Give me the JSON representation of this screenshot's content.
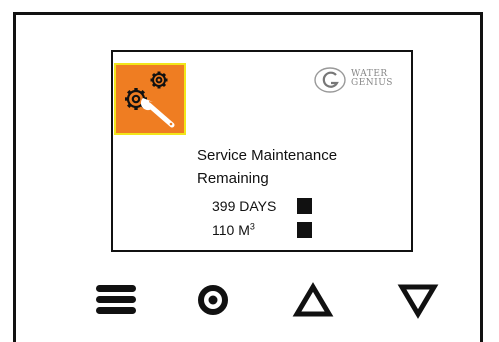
{
  "screen": {
    "icon": "service-gears-wrench-icon",
    "logo": {
      "icon": "water-genius-g-logo-icon",
      "line1": "WATER",
      "line2": "GENIUS"
    },
    "title_line1": "Service Maintenance",
    "title_line2": "Remaining",
    "rows": [
      {
        "label": "399 DAYS",
        "indicator": "filled-square"
      },
      {
        "label": "110 M",
        "superscript": "3",
        "indicator": "filled-square"
      }
    ]
  },
  "buttons": [
    {
      "name": "menu-button",
      "icon": "hamburger-menu-icon"
    },
    {
      "name": "select-button",
      "icon": "ring-circle-icon"
    },
    {
      "name": "up-button",
      "icon": "triangle-up-icon"
    },
    {
      "name": "down-button",
      "icon": "triangle-down-icon"
    }
  ],
  "colors": {
    "icon_bg": "#ef7d22",
    "icon_border": "#f2e61a",
    "foreground": "#111111",
    "logo_text": "#888888"
  }
}
